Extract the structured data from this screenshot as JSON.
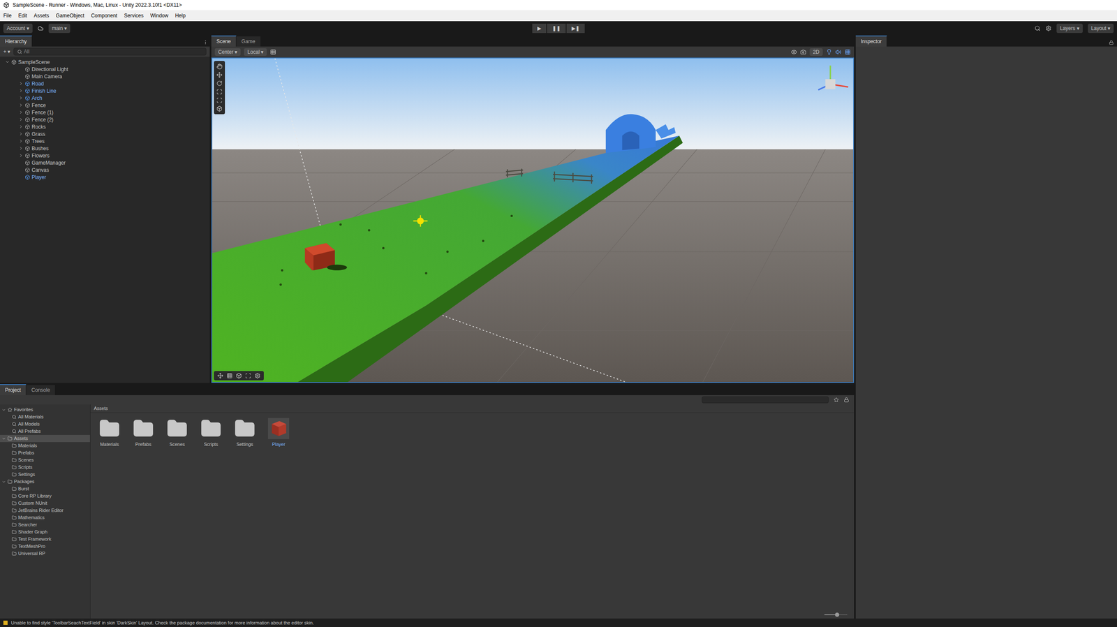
{
  "window": {
    "title": "SampleScene - Runner - Windows, Mac, Linux - Unity 2022.3.10f1 <DX11>"
  },
  "menu": [
    "File",
    "Edit",
    "Assets",
    "GameObject",
    "Component",
    "Services",
    "Window",
    "Help"
  ],
  "toolbar": {
    "account": "Account ▾",
    "branch": "main ▾",
    "play": [
      "▶",
      "❚❚",
      "▶❚"
    ],
    "right": [
      "Layers ▾",
      "Layout ▾"
    ]
  },
  "hierarchy": {
    "tab": "Hierarchy",
    "add_button": "+ ▾",
    "search_placeholder": "All",
    "scene": "SampleScene",
    "items": [
      {
        "name": "Directional Light",
        "prefab": false,
        "has_children": false
      },
      {
        "name": "Main Camera",
        "prefab": false,
        "has_children": false
      },
      {
        "name": "Road",
        "prefab": true,
        "has_children": true
      },
      {
        "name": "Finish Line",
        "prefab": true,
        "has_children": true
      },
      {
        "name": "Arch",
        "prefab": true,
        "has_children": true
      },
      {
        "name": "Fence",
        "prefab": false,
        "has_children": true
      },
      {
        "name": "Fence (1)",
        "prefab": false,
        "has_children": true
      },
      {
        "name": "Fence (2)",
        "prefab": false,
        "has_children": true
      },
      {
        "name": "Rocks",
        "prefab": false,
        "has_children": true
      },
      {
        "name": "Grass",
        "prefab": false,
        "has_children": true
      },
      {
        "name": "Trees",
        "prefab": false,
        "has_children": true
      },
      {
        "name": "Bushes",
        "prefab": false,
        "has_children": true
      },
      {
        "name": "Flowers",
        "prefab": false,
        "has_children": true
      },
      {
        "name": "GameManager",
        "prefab": false,
        "has_children": false
      },
      {
        "name": "Canvas",
        "prefab": false,
        "has_children": false
      },
      {
        "name": "Player",
        "prefab": true,
        "has_children": false
      }
    ]
  },
  "scene": {
    "tabs": [
      {
        "label": "Scene",
        "selected": true
      },
      {
        "label": "Game",
        "selected": false
      }
    ],
    "pivot": "Center ▾",
    "space": "Local ▾",
    "view_mode": "2D"
  },
  "inspector": {
    "tab": "Inspector"
  },
  "project": {
    "tabs": [
      {
        "label": "Project",
        "selected": true
      },
      {
        "label": "Console",
        "selected": false
      }
    ],
    "tree": [
      {
        "label": "Favorites",
        "depth": 0,
        "selected": false,
        "kind": "star"
      },
      {
        "label": "All Materials",
        "depth": 1,
        "selected": false,
        "kind": "search"
      },
      {
        "label": "All Models",
        "depth": 1,
        "selected": false,
        "kind": "search"
      },
      {
        "label": "All Prefabs",
        "depth": 1,
        "selected": false,
        "kind": "search"
      },
      {
        "label": "Assets",
        "depth": 0,
        "selected": true,
        "kind": "folder"
      },
      {
        "label": "Materials",
        "depth": 1,
        "selected": false,
        "kind": "folder"
      },
      {
        "label": "Prefabs",
        "depth": 1,
        "selected": false,
        "kind": "folder"
      },
      {
        "label": "Scenes",
        "depth": 1,
        "selected": false,
        "kind": "folder"
      },
      {
        "label": "Scripts",
        "depth": 1,
        "selected": false,
        "kind": "folder"
      },
      {
        "label": "Settings",
        "depth": 1,
        "selected": false,
        "kind": "folder"
      },
      {
        "label": "Packages",
        "depth": 0,
        "selected": false,
        "kind": "folder"
      },
      {
        "label": "Burst",
        "depth": 1,
        "selected": false,
        "kind": "folder"
      },
      {
        "label": "Core RP Library",
        "depth": 1,
        "selected": false,
        "kind": "folder"
      },
      {
        "label": "Custom NUnit",
        "depth": 1,
        "selected": false,
        "kind": "folder"
      },
      {
        "label": "JetBrains Rider Editor",
        "depth": 1,
        "selected": false,
        "kind": "folder"
      },
      {
        "label": "Mathematics",
        "depth": 1,
        "selected": false,
        "kind": "folder"
      },
      {
        "label": "Searcher",
        "depth": 1,
        "selected": false,
        "kind": "folder"
      },
      {
        "label": "Shader Graph",
        "depth": 1,
        "selected": false,
        "kind": "folder"
      },
      {
        "label": "Test Framework",
        "depth": 1,
        "selected": false,
        "kind": "folder"
      },
      {
        "label": "TextMeshPro",
        "depth": 1,
        "selected": false,
        "kind": "folder"
      },
      {
        "label": "Universal RP",
        "depth": 1,
        "selected": false,
        "kind": "folder"
      }
    ],
    "breadcrumb": "Assets",
    "assets": [
      {
        "name": "Materials",
        "kind": "folder"
      },
      {
        "name": "Prefabs",
        "kind": "folder"
      },
      {
        "name": "Scenes",
        "kind": "folder"
      },
      {
        "name": "Scripts",
        "kind": "folder"
      },
      {
        "name": "Settings",
        "kind": "folder"
      },
      {
        "name": "Player",
        "kind": "prefab"
      }
    ],
    "icon_size_level": 0.55
  },
  "status": {
    "message": "Unable to find style 'ToolbarSeachTextField' in skin 'DarkSkin' Layout. Check the package documentation for more information about the editor skin."
  }
}
